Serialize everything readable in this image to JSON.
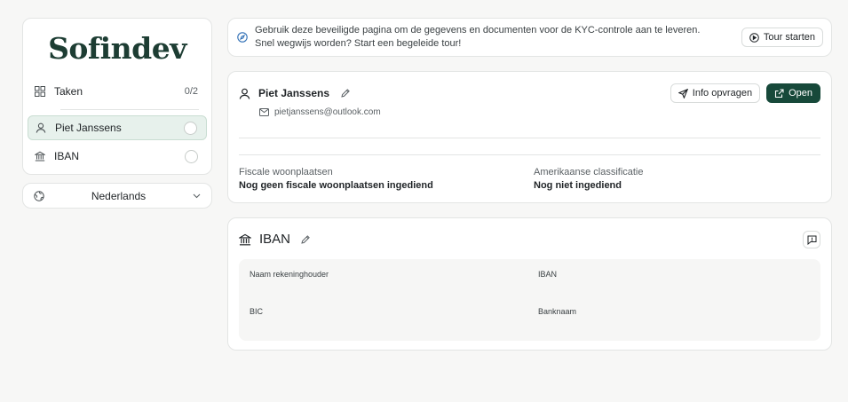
{
  "sidebar": {
    "logo": "Sofindev",
    "tasks": {
      "label": "Taken",
      "count": "0/2"
    },
    "items": [
      {
        "label": "Piet Janssens",
        "active": true
      },
      {
        "label": "IBAN",
        "active": false
      }
    ]
  },
  "language": {
    "label": "Nederlands"
  },
  "banner": {
    "text": "Gebruik deze beveiligde pagina om de gegevens en documenten voor de KYC-controle aan te leveren. Snel wegwijs worden? Start een begeleide tour!",
    "tour_button": "Tour starten"
  },
  "person": {
    "name": "Piet Janssens",
    "email": "pietjanssens@outlook.com",
    "request_info_button": "Info opvragen",
    "open_button": "Open",
    "tax_residence_label": "Fiscale woonplaatsen",
    "tax_residence_value": "Nog geen fiscale woonplaatsen ingediend",
    "us_classification_label": "Amerikaanse classificatie",
    "us_classification_value": "Nog niet ingediend"
  },
  "iban_section": {
    "title": "IBAN",
    "fields": {
      "account_holder": "Naam rekeninghouder",
      "iban": "IBAN",
      "bic": "BIC",
      "bank_name": "Banknaam"
    }
  },
  "colors": {
    "brand": "#1d3d33",
    "accent": "#17493a",
    "active_bg": "#e7f1ec"
  }
}
